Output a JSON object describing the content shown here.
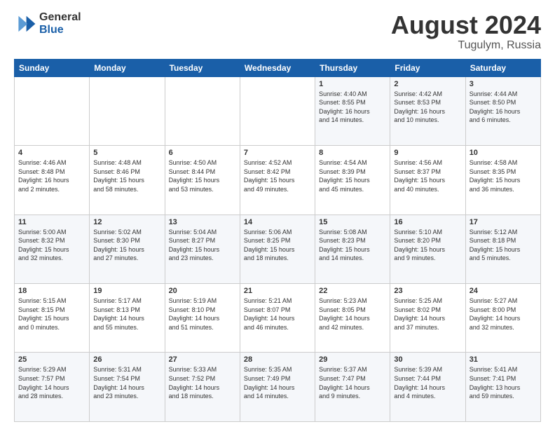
{
  "logo": {
    "general": "General",
    "blue": "Blue"
  },
  "title": "August 2024",
  "location": "Tugulym, Russia",
  "days_of_week": [
    "Sunday",
    "Monday",
    "Tuesday",
    "Wednesday",
    "Thursday",
    "Friday",
    "Saturday"
  ],
  "weeks": [
    [
      {
        "day": "",
        "info": ""
      },
      {
        "day": "",
        "info": ""
      },
      {
        "day": "",
        "info": ""
      },
      {
        "day": "",
        "info": ""
      },
      {
        "day": "1",
        "info": "Sunrise: 4:40 AM\nSunset: 8:55 PM\nDaylight: 16 hours\nand 14 minutes."
      },
      {
        "day": "2",
        "info": "Sunrise: 4:42 AM\nSunset: 8:53 PM\nDaylight: 16 hours\nand 10 minutes."
      },
      {
        "day": "3",
        "info": "Sunrise: 4:44 AM\nSunset: 8:50 PM\nDaylight: 16 hours\nand 6 minutes."
      }
    ],
    [
      {
        "day": "4",
        "info": "Sunrise: 4:46 AM\nSunset: 8:48 PM\nDaylight: 16 hours\nand 2 minutes."
      },
      {
        "day": "5",
        "info": "Sunrise: 4:48 AM\nSunset: 8:46 PM\nDaylight: 15 hours\nand 58 minutes."
      },
      {
        "day": "6",
        "info": "Sunrise: 4:50 AM\nSunset: 8:44 PM\nDaylight: 15 hours\nand 53 minutes."
      },
      {
        "day": "7",
        "info": "Sunrise: 4:52 AM\nSunset: 8:42 PM\nDaylight: 15 hours\nand 49 minutes."
      },
      {
        "day": "8",
        "info": "Sunrise: 4:54 AM\nSunset: 8:39 PM\nDaylight: 15 hours\nand 45 minutes."
      },
      {
        "day": "9",
        "info": "Sunrise: 4:56 AM\nSunset: 8:37 PM\nDaylight: 15 hours\nand 40 minutes."
      },
      {
        "day": "10",
        "info": "Sunrise: 4:58 AM\nSunset: 8:35 PM\nDaylight: 15 hours\nand 36 minutes."
      }
    ],
    [
      {
        "day": "11",
        "info": "Sunrise: 5:00 AM\nSunset: 8:32 PM\nDaylight: 15 hours\nand 32 minutes."
      },
      {
        "day": "12",
        "info": "Sunrise: 5:02 AM\nSunset: 8:30 PM\nDaylight: 15 hours\nand 27 minutes."
      },
      {
        "day": "13",
        "info": "Sunrise: 5:04 AM\nSunset: 8:27 PM\nDaylight: 15 hours\nand 23 minutes."
      },
      {
        "day": "14",
        "info": "Sunrise: 5:06 AM\nSunset: 8:25 PM\nDaylight: 15 hours\nand 18 minutes."
      },
      {
        "day": "15",
        "info": "Sunrise: 5:08 AM\nSunset: 8:23 PM\nDaylight: 15 hours\nand 14 minutes."
      },
      {
        "day": "16",
        "info": "Sunrise: 5:10 AM\nSunset: 8:20 PM\nDaylight: 15 hours\nand 9 minutes."
      },
      {
        "day": "17",
        "info": "Sunrise: 5:12 AM\nSunset: 8:18 PM\nDaylight: 15 hours\nand 5 minutes."
      }
    ],
    [
      {
        "day": "18",
        "info": "Sunrise: 5:15 AM\nSunset: 8:15 PM\nDaylight: 15 hours\nand 0 minutes."
      },
      {
        "day": "19",
        "info": "Sunrise: 5:17 AM\nSunset: 8:13 PM\nDaylight: 14 hours\nand 55 minutes."
      },
      {
        "day": "20",
        "info": "Sunrise: 5:19 AM\nSunset: 8:10 PM\nDaylight: 14 hours\nand 51 minutes."
      },
      {
        "day": "21",
        "info": "Sunrise: 5:21 AM\nSunset: 8:07 PM\nDaylight: 14 hours\nand 46 minutes."
      },
      {
        "day": "22",
        "info": "Sunrise: 5:23 AM\nSunset: 8:05 PM\nDaylight: 14 hours\nand 42 minutes."
      },
      {
        "day": "23",
        "info": "Sunrise: 5:25 AM\nSunset: 8:02 PM\nDaylight: 14 hours\nand 37 minutes."
      },
      {
        "day": "24",
        "info": "Sunrise: 5:27 AM\nSunset: 8:00 PM\nDaylight: 14 hours\nand 32 minutes."
      }
    ],
    [
      {
        "day": "25",
        "info": "Sunrise: 5:29 AM\nSunset: 7:57 PM\nDaylight: 14 hours\nand 28 minutes."
      },
      {
        "day": "26",
        "info": "Sunrise: 5:31 AM\nSunset: 7:54 PM\nDaylight: 14 hours\nand 23 minutes."
      },
      {
        "day": "27",
        "info": "Sunrise: 5:33 AM\nSunset: 7:52 PM\nDaylight: 14 hours\nand 18 minutes."
      },
      {
        "day": "28",
        "info": "Sunrise: 5:35 AM\nSunset: 7:49 PM\nDaylight: 14 hours\nand 14 minutes."
      },
      {
        "day": "29",
        "info": "Sunrise: 5:37 AM\nSunset: 7:47 PM\nDaylight: 14 hours\nand 9 minutes."
      },
      {
        "day": "30",
        "info": "Sunrise: 5:39 AM\nSunset: 7:44 PM\nDaylight: 14 hours\nand 4 minutes."
      },
      {
        "day": "31",
        "info": "Sunrise: 5:41 AM\nSunset: 7:41 PM\nDaylight: 13 hours\nand 59 minutes."
      }
    ]
  ]
}
